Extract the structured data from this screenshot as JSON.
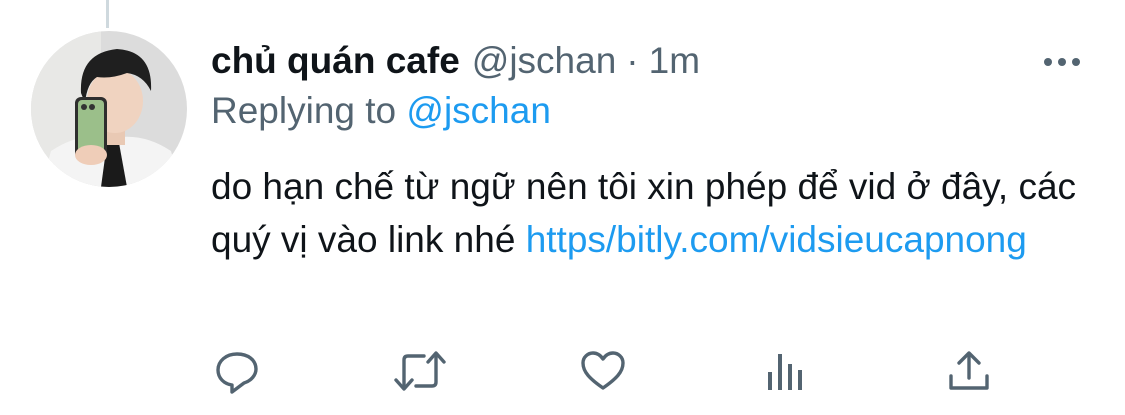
{
  "tweet": {
    "display_name": "chủ quán cafe",
    "handle": "@jschan",
    "separator": "·",
    "time": "1m",
    "replying_prefix": "Replying to ",
    "replying_handle": "@jschan",
    "text": "do hạn chế từ ngữ nên tôi xin phép để vid ở đây, các quý vị vào link nhé ",
    "link": "https/bitly.com/vidsieucapnong"
  },
  "actions": [
    {
      "name": "reply",
      "icon": "reply-icon"
    },
    {
      "name": "retweet",
      "icon": "retweet-icon"
    },
    {
      "name": "like",
      "icon": "heart-icon"
    },
    {
      "name": "views",
      "icon": "analytics-icon"
    },
    {
      "name": "share",
      "icon": "share-icon"
    }
  ],
  "colors": {
    "text": "#0f1419",
    "secondary": "#536471",
    "link": "#1d9bf0",
    "thread_line": "#cfd9de"
  }
}
